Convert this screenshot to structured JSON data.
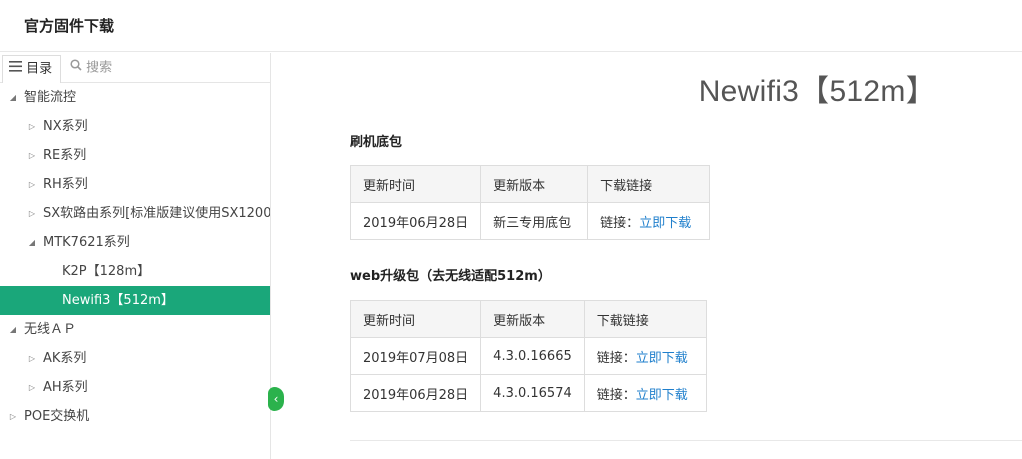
{
  "header": {
    "title": "官方固件下载"
  },
  "sidebar": {
    "tab_toc": "目录",
    "tab_search": "搜索",
    "tree": [
      {
        "label": "智能流控",
        "level": 0,
        "state": "open"
      },
      {
        "label": "NX系列",
        "level": 1,
        "state": "closed"
      },
      {
        "label": "RE系列",
        "level": 1,
        "state": "closed"
      },
      {
        "label": "RH系列",
        "level": 1,
        "state": "closed"
      },
      {
        "label": "SX软路由系列[标准版建议使用SX1200",
        "level": 1,
        "state": "closed"
      },
      {
        "label": "MTK7621系列",
        "level": 1,
        "state": "open"
      },
      {
        "label": "K2P【128m】",
        "level": 2,
        "state": "leaf"
      },
      {
        "label": "Newifi3【512m】",
        "level": 2,
        "state": "leaf",
        "active": true
      },
      {
        "label": "无线ＡＰ",
        "level": 0,
        "state": "open"
      },
      {
        "label": "AK系列",
        "level": 1,
        "state": "closed"
      },
      {
        "label": "AH系列",
        "level": 1,
        "state": "closed"
      },
      {
        "label": "POE交换机",
        "level": 0,
        "state": "closed"
      }
    ]
  },
  "main": {
    "title": "Newifi3【512m】",
    "sections": [
      {
        "title": "刷机底包",
        "headers": [
          "更新时间",
          "更新版本",
          "下载链接"
        ],
        "rows": [
          {
            "date": "2019年06月28日",
            "version": "新三专用底包",
            "link_prefix": "链接：",
            "link_text": "立即下载"
          }
        ]
      },
      {
        "title": "web升级包（去无线适配512m）",
        "headers": [
          "更新时间",
          "更新版本",
          "下载链接"
        ],
        "rows": [
          {
            "date": "2019年07月08日",
            "version": "4.3.0.16665",
            "link_prefix": "链接：",
            "link_text": "立即下载"
          },
          {
            "date": "2019年06月28日",
            "version": "4.3.0.16574",
            "link_prefix": "链接：",
            "link_text": "立即下载"
          }
        ]
      }
    ]
  },
  "colors": {
    "active": "#1aa77a",
    "link": "#1f7fcc",
    "collapse": "#2bb24c"
  },
  "icons": {
    "toc": "list-icon",
    "search": "search-icon",
    "collapse": "chevron-left-icon"
  }
}
